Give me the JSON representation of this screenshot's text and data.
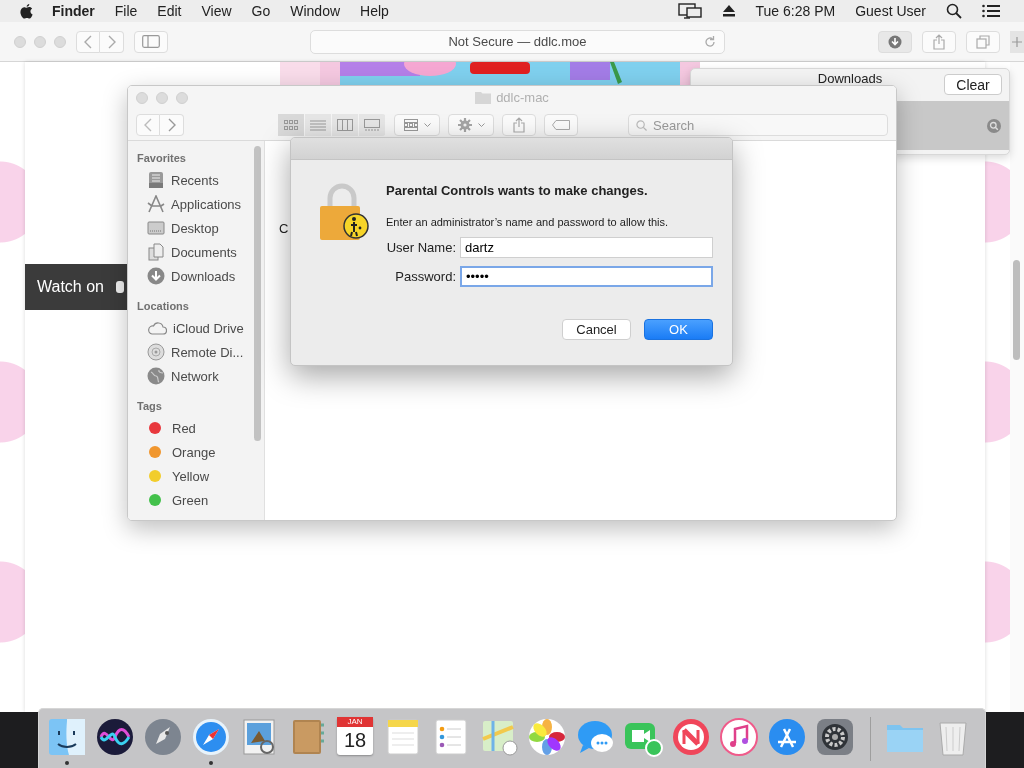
{
  "menu_bar": {
    "app_name": "Finder",
    "menus": [
      "File",
      "Edit",
      "View",
      "Go",
      "Window",
      "Help"
    ],
    "clock": "Tue 6:28 PM",
    "user": "Guest User"
  },
  "browser": {
    "address": "Not Secure — ddlc.moe",
    "page": {
      "watch_label": "Watch on"
    },
    "downloads_popover": {
      "title": "Downloads",
      "clear_button": "Clear"
    }
  },
  "finder": {
    "title": "ddlc-mac",
    "search": {
      "placeholder": "Search"
    },
    "content_text": "C",
    "sidebar": [
      {
        "heading": "Favorites",
        "items": [
          {
            "label": "Recents",
            "kind": "recents"
          },
          {
            "label": "Applications",
            "kind": "applications"
          },
          {
            "label": "Desktop",
            "kind": "desktop"
          },
          {
            "label": "Documents",
            "kind": "documents"
          },
          {
            "label": "Downloads",
            "kind": "downloads"
          }
        ]
      },
      {
        "heading": "Locations",
        "items": [
          {
            "label": "iCloud Drive",
            "kind": "cloud"
          },
          {
            "label": "Remote Di...",
            "kind": "disc"
          },
          {
            "label": "Network",
            "kind": "network"
          }
        ]
      },
      {
        "heading": "Tags",
        "items": [
          {
            "label": "Red",
            "kind": "tag",
            "color": "#e8383d"
          },
          {
            "label": "Orange",
            "kind": "tag",
            "color": "#f0962e"
          },
          {
            "label": "Yellow",
            "kind": "tag",
            "color": "#f2cd2b"
          },
          {
            "label": "Green",
            "kind": "tag",
            "color": "#43c14b"
          }
        ]
      }
    ]
  },
  "dialog": {
    "title": "Parental Controls wants to make changes.",
    "message": "Enter an administrator’s name and password to allow this.",
    "fields": [
      {
        "label": "User Name:",
        "value": "dartz",
        "focused": false
      },
      {
        "label": "Password:",
        "value": "•••••",
        "focused": true
      }
    ],
    "buttons": [
      {
        "label": "Cancel",
        "default": false
      },
      {
        "label": "OK",
        "default": true
      }
    ]
  },
  "dock": {
    "apps": [
      {
        "kind": "finder",
        "running": true
      },
      {
        "kind": "siri",
        "running": false
      },
      {
        "kind": "launchpad",
        "running": false
      },
      {
        "kind": "safari",
        "running": true
      },
      {
        "kind": "preview",
        "running": false
      },
      {
        "kind": "contacts",
        "running": false
      },
      {
        "kind": "calendar",
        "running": false,
        "month": "JAN",
        "day": "18"
      },
      {
        "kind": "notes",
        "running": false
      },
      {
        "kind": "reminders",
        "running": false
      },
      {
        "kind": "maps",
        "running": false
      },
      {
        "kind": "photos",
        "running": false
      },
      {
        "kind": "messages",
        "running": false
      },
      {
        "kind": "facetime",
        "running": false
      },
      {
        "kind": "news",
        "running": false
      },
      {
        "kind": "music",
        "running": false
      },
      {
        "kind": "appstore",
        "running": false
      },
      {
        "kind": "settings",
        "running": false
      },
      {
        "kind": "separator",
        "running": false
      },
      {
        "kind": "folder",
        "running": false
      },
      {
        "kind": "trash",
        "running": false
      }
    ]
  }
}
